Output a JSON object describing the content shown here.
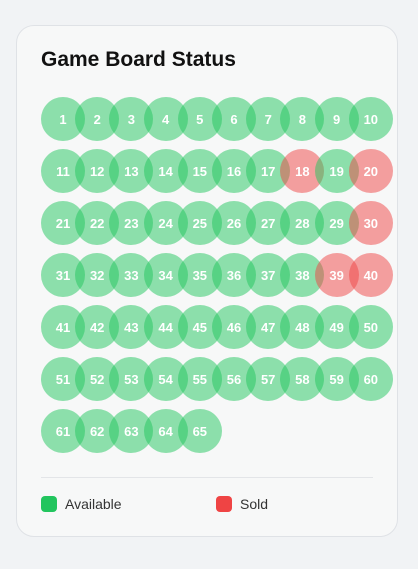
{
  "title": "Game Board Status",
  "colors": {
    "available": "#22c55e",
    "sold": "#ef4444"
  },
  "seats": [
    {
      "label": "1",
      "status": "available"
    },
    {
      "label": "2",
      "status": "available"
    },
    {
      "label": "3",
      "status": "available"
    },
    {
      "label": "4",
      "status": "available"
    },
    {
      "label": "5",
      "status": "available"
    },
    {
      "label": "6",
      "status": "available"
    },
    {
      "label": "7",
      "status": "available"
    },
    {
      "label": "8",
      "status": "available"
    },
    {
      "label": "9",
      "status": "available"
    },
    {
      "label": "10",
      "status": "available"
    },
    {
      "label": "11",
      "status": "available"
    },
    {
      "label": "12",
      "status": "available"
    },
    {
      "label": "13",
      "status": "available"
    },
    {
      "label": "14",
      "status": "available"
    },
    {
      "label": "15",
      "status": "available"
    },
    {
      "label": "16",
      "status": "available"
    },
    {
      "label": "17",
      "status": "available"
    },
    {
      "label": "18",
      "status": "sold"
    },
    {
      "label": "19",
      "status": "available"
    },
    {
      "label": "20",
      "status": "sold"
    },
    {
      "label": "21",
      "status": "available"
    },
    {
      "label": "22",
      "status": "available"
    },
    {
      "label": "23",
      "status": "available"
    },
    {
      "label": "24",
      "status": "available"
    },
    {
      "label": "25",
      "status": "available"
    },
    {
      "label": "26",
      "status": "available"
    },
    {
      "label": "27",
      "status": "available"
    },
    {
      "label": "28",
      "status": "available"
    },
    {
      "label": "29",
      "status": "available"
    },
    {
      "label": "30",
      "status": "sold"
    },
    {
      "label": "31",
      "status": "available"
    },
    {
      "label": "32",
      "status": "available"
    },
    {
      "label": "33",
      "status": "available"
    },
    {
      "label": "34",
      "status": "available"
    },
    {
      "label": "35",
      "status": "available"
    },
    {
      "label": "36",
      "status": "available"
    },
    {
      "label": "37",
      "status": "available"
    },
    {
      "label": "38",
      "status": "available"
    },
    {
      "label": "39",
      "status": "sold"
    },
    {
      "label": "40",
      "status": "sold"
    },
    {
      "label": "41",
      "status": "available"
    },
    {
      "label": "42",
      "status": "available"
    },
    {
      "label": "43",
      "status": "available"
    },
    {
      "label": "44",
      "status": "available"
    },
    {
      "label": "45",
      "status": "available"
    },
    {
      "label": "46",
      "status": "available"
    },
    {
      "label": "47",
      "status": "available"
    },
    {
      "label": "48",
      "status": "available"
    },
    {
      "label": "49",
      "status": "available"
    },
    {
      "label": "50",
      "status": "available"
    },
    {
      "label": "51",
      "status": "available"
    },
    {
      "label": "52",
      "status": "available"
    },
    {
      "label": "53",
      "status": "available"
    },
    {
      "label": "54",
      "status": "available"
    },
    {
      "label": "55",
      "status": "available"
    },
    {
      "label": "56",
      "status": "available"
    },
    {
      "label": "57",
      "status": "available"
    },
    {
      "label": "58",
      "status": "available"
    },
    {
      "label": "59",
      "status": "available"
    },
    {
      "label": "60",
      "status": "available"
    },
    {
      "label": "61",
      "status": "available"
    },
    {
      "label": "62",
      "status": "available"
    },
    {
      "label": "63",
      "status": "available"
    },
    {
      "label": "64",
      "status": "available"
    },
    {
      "label": "65",
      "status": "available"
    }
  ],
  "legend": {
    "available_label": "Available",
    "sold_label": "Sold"
  }
}
